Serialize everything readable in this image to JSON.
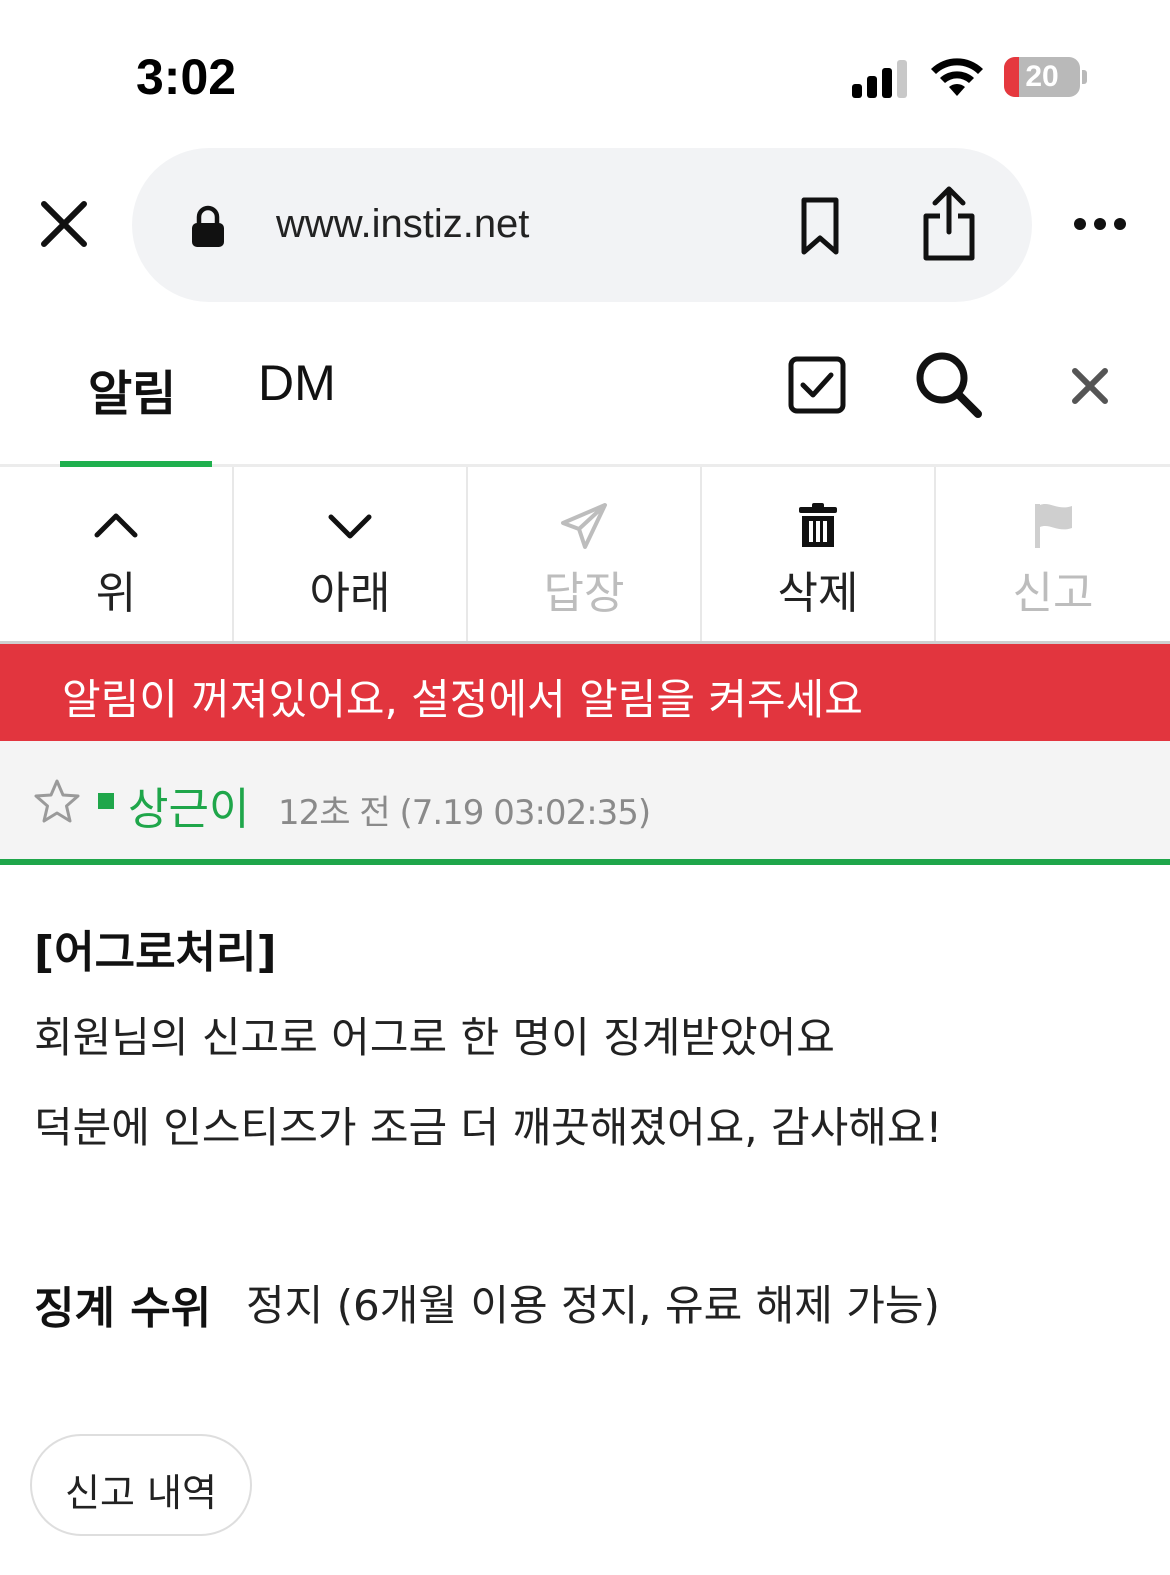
{
  "status_bar": {
    "time": "3:02",
    "battery_level": "20",
    "battery_fraction": 0.2,
    "battery_color": "#e5383e",
    "icons": [
      "signal-icon",
      "wifi-icon",
      "battery-icon"
    ]
  },
  "browser": {
    "url": "www.instiz.net",
    "icons": [
      "close-icon",
      "lock-icon",
      "bookmark-icon",
      "share-icon",
      "more-icon"
    ]
  },
  "tabs": {
    "items": [
      {
        "label": "알림",
        "active": true
      },
      {
        "label": "DM",
        "active": false
      }
    ],
    "accent_color": "#1fb04e",
    "icons": [
      "checkbox-icon",
      "search-icon",
      "close-icon"
    ]
  },
  "toolbar": {
    "items": [
      {
        "label": "위",
        "icon": "chevron-up-icon",
        "enabled": true
      },
      {
        "label": "아래",
        "icon": "chevron-down-icon",
        "enabled": true
      },
      {
        "label": "답장",
        "icon": "paper-plane-icon",
        "enabled": false
      },
      {
        "label": "삭제",
        "icon": "trash-icon",
        "enabled": true
      },
      {
        "label": "신고",
        "icon": "flag-icon",
        "enabled": false
      }
    ]
  },
  "alert": {
    "text": "알림이 꺼져있어요, 설정에서 알림을 켜주세요",
    "color": "#e2353e"
  },
  "message": {
    "sender": "상근이",
    "time": "12초 전 (7.19 03:02:35)",
    "title": "[어그로처리]",
    "lines": [
      "회원님의 신고로 어그로 한 명이 징계받았어요",
      "덕분에 인스티즈가 조금 더 깨끗해졌어요, 감사해요!"
    ],
    "penalty_label": "징계 수위",
    "penalty_value": "정지 (6개월 이용 정지, 유료 해제 가능)",
    "history_button": "신고 내역",
    "accent_color": "#1fa64a"
  }
}
